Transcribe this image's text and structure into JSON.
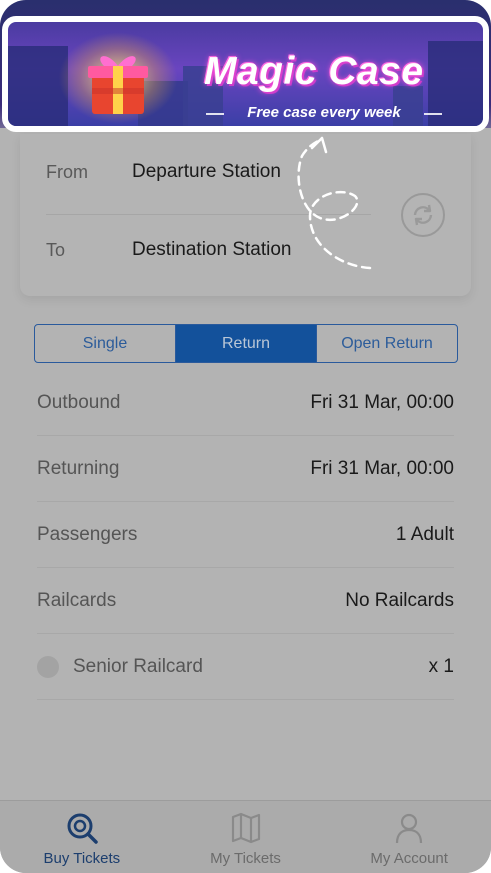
{
  "banner": {
    "title": "Magic Case",
    "subtitle": "Free case every week"
  },
  "journey": {
    "from_label": "From",
    "from_value": "Departure Station",
    "to_label": "To",
    "to_value": "Destination Station",
    "swap_icon": "swap-icon"
  },
  "ticket_types": {
    "options": [
      "Single",
      "Return",
      "Open Return"
    ],
    "selected": "Return"
  },
  "details": {
    "outbound_label": "Outbound",
    "outbound_value": "Fri 31 Mar, 00:00",
    "returning_label": "Returning",
    "returning_value": "Fri 31 Mar, 00:00",
    "passengers_label": "Passengers",
    "passengers_value": "1 Adult",
    "railcards_label": "Railcards",
    "railcards_value": "No Railcards",
    "railcard_item_label": "Senior Railcard",
    "railcard_item_count": "x 1"
  },
  "tabbar": {
    "items": [
      {
        "label": "Buy Tickets",
        "icon": "search-icon",
        "active": true
      },
      {
        "label": "My Tickets",
        "icon": "map-icon",
        "active": false
      },
      {
        "label": "My Account",
        "icon": "user-icon",
        "active": false
      }
    ]
  },
  "colors": {
    "accent": "#13519b",
    "overlay": "#b3b3b3"
  }
}
